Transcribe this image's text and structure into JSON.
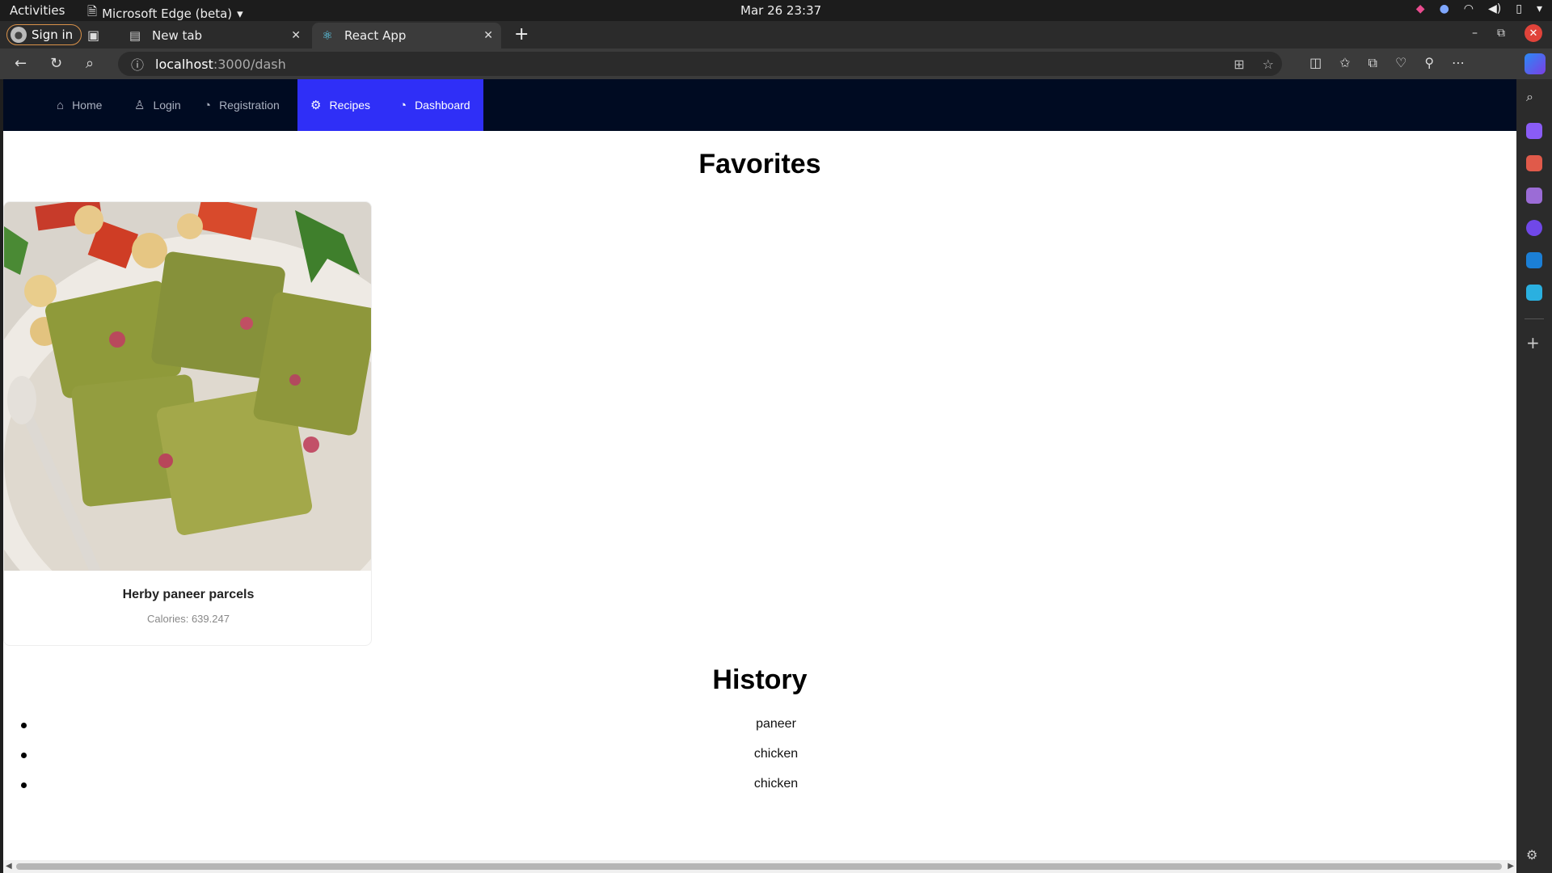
{
  "os_bar": {
    "activities": "Activities",
    "app_menu": "Microsoft Edge (beta)",
    "clock": "Mar 26  23:37"
  },
  "browser": {
    "sign_in": "Sign in",
    "tabs": [
      {
        "title": "New tab",
        "active": false
      },
      {
        "title": "React App",
        "active": true
      }
    ],
    "url_host": "localhost",
    "url_path": ":3000/dash"
  },
  "app": {
    "nav": [
      {
        "label": "Home",
        "icon": "home-icon",
        "active": false
      },
      {
        "label": "Login",
        "icon": "user-icon",
        "active": false
      },
      {
        "label": "Registration",
        "icon": "gauge-icon",
        "active": false
      },
      {
        "label": "Recipes",
        "icon": "gear-icon",
        "active": true
      },
      {
        "label": "Dashboard",
        "icon": "gauge-icon",
        "active": true
      }
    ],
    "favorites_title": "Favorites",
    "favorites": [
      {
        "name": "Herby paneer parcels",
        "calories": "Calories: 639.247"
      }
    ],
    "history_title": "History",
    "history": [
      "paneer",
      "chicken",
      "chicken"
    ]
  },
  "colors": {
    "nav_bg": "#000b22",
    "nav_active": "#2f2ff7"
  }
}
